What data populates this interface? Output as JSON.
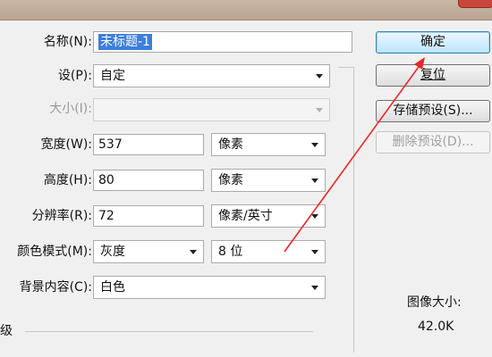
{
  "dialog": {
    "name": {
      "label": "名称(N):",
      "value": "未标题-1"
    },
    "preset": {
      "label": "设(P):",
      "value": "自定"
    },
    "size": {
      "label": "大小(I):",
      "value": ""
    },
    "width": {
      "label": "宽度(W):",
      "value": "537",
      "unit": "像素"
    },
    "height": {
      "label": "高度(H):",
      "value": "80",
      "unit": "像素"
    },
    "resolution": {
      "label": "分辨率(R):",
      "value": "72",
      "unit": "像素/英寸"
    },
    "color_mode": {
      "label": "颜色模式(M):",
      "value": "灰度",
      "bits": "8 位"
    },
    "background": {
      "label": "背景内容(C):",
      "value": "白色"
    },
    "advanced_label": "级"
  },
  "buttons": {
    "ok": "确定",
    "reset": "复位",
    "save_preset": "存储预设(S)...",
    "delete_preset": "删除预设(D)..."
  },
  "image_size": {
    "label": "图像大小:",
    "value": "42.0K"
  },
  "colors": {
    "annotation_arrow": "#e8282a",
    "selection": "#3d7ed8"
  },
  "icons": [
    "dropdown-arrow-icon"
  ]
}
